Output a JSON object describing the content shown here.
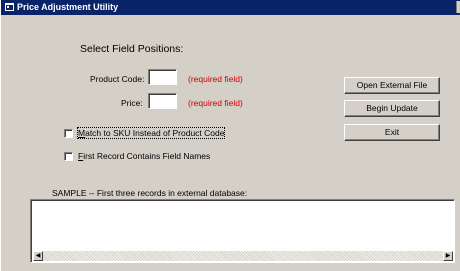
{
  "window": {
    "title": "Price Adjustment Utility"
  },
  "form": {
    "heading": "Select Field Positions:",
    "product_code": {
      "label": "Product Code:",
      "value": "",
      "required_note": "(required field)"
    },
    "price": {
      "label": "Price:",
      "value": "",
      "required_note": "(required field)"
    },
    "options": {
      "match_sku": {
        "label_accel": "M",
        "label_rest": "atch to SKU Instead of Product Code",
        "checked": false
      },
      "first_record": {
        "label_accel": "F",
        "label_rest": "irst Record Contains Field Names",
        "checked": false
      }
    }
  },
  "buttons": {
    "open_file": "Open External File",
    "begin_update": "Begin Update",
    "exit": "Exit"
  },
  "sample": {
    "caption": "SAMPLE -- First three records in external database:",
    "content": ""
  },
  "icons": {
    "app": "app-icon",
    "scroll_left": "scroll-left-arrow-icon",
    "scroll_right": "scroll-right-arrow-icon"
  },
  "colors": {
    "titlebar": "#0a246a",
    "face": "#d4d0c8",
    "required": "#cc0000"
  }
}
